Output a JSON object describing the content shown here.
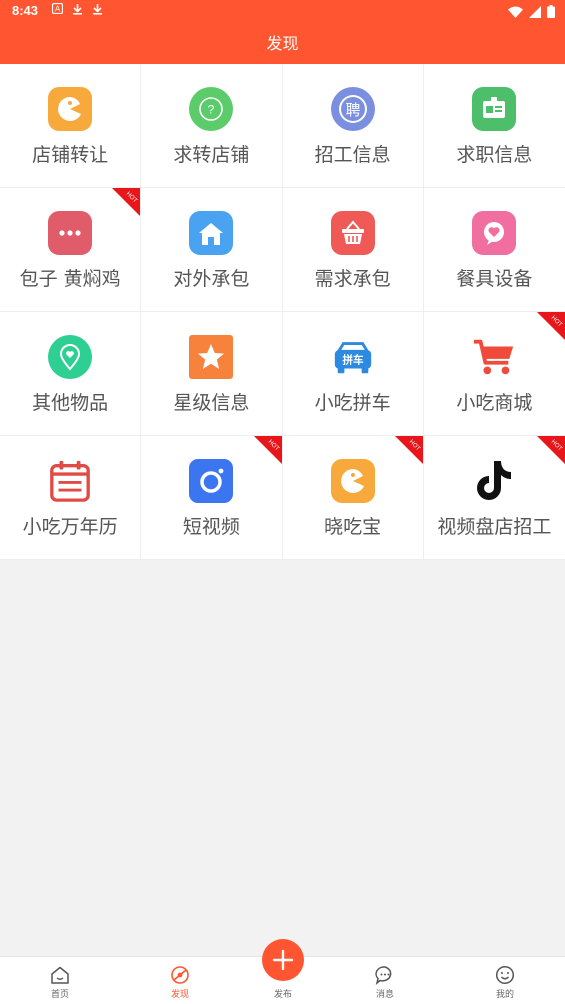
{
  "status_bar": {
    "time": "8:43",
    "left_icons": [
      "a-icon",
      "download-icon",
      "download-icon"
    ],
    "right_icons": [
      "wifi-icon",
      "signal-icon",
      "battery-icon"
    ]
  },
  "header": {
    "title": "发现"
  },
  "grid": {
    "items": [
      {
        "label": "店铺转让",
        "icon": "pacman-icon",
        "color": "#f7a93b",
        "hot": false
      },
      {
        "label": "求转店铺",
        "icon": "question-icon",
        "color": "#5ccc6b",
        "hot": false
      },
      {
        "label": "招工信息",
        "icon": "hire-icon",
        "color": "#7b8fe0",
        "hot": false
      },
      {
        "label": "求职信息",
        "icon": "id-card-icon",
        "color": "#4dbe6a",
        "hot": false
      },
      {
        "label": "包子 黄焖鸡",
        "icon": "more-dots-icon",
        "color": "#e05c6b",
        "hot": true
      },
      {
        "label": "对外承包",
        "icon": "house-icon",
        "color": "#4aa3f0",
        "hot": false
      },
      {
        "label": "需求承包",
        "icon": "basket-icon",
        "color": "#ef5a57",
        "hot": false
      },
      {
        "label": "餐具设备",
        "icon": "chat-heart-icon",
        "color": "#f06ea0",
        "hot": false
      },
      {
        "label": "其他物品",
        "icon": "location-heart-icon",
        "color": "#2ecf93",
        "hot": false
      },
      {
        "label": "星级信息",
        "icon": "star-icon",
        "color": "#f7823b",
        "hot": false
      },
      {
        "label": "小吃拼车",
        "icon": "carpool-icon",
        "color": "#2c8ae0",
        "hot": false,
        "badge_text": "拼车"
      },
      {
        "label": "小吃商城",
        "icon": "cart-icon",
        "color": "#f04b3a",
        "hot": true
      },
      {
        "label": "小吃万年历",
        "icon": "calendar-icon",
        "color": "#e04b45",
        "hot": false
      },
      {
        "label": "短视频",
        "icon": "camera-icon",
        "color": "#3b76f0",
        "hot": true
      },
      {
        "label": "晓吃宝",
        "icon": "pacman-icon",
        "color": "#f7a93b",
        "hot": true
      },
      {
        "label": "视频盘店招工",
        "icon": "tiktok-icon",
        "color": "#111111",
        "hot": true
      }
    ],
    "hot_text": "HOT"
  },
  "bottom_nav": {
    "items": [
      {
        "label": "首页",
        "icon": "home-icon",
        "active": false
      },
      {
        "label": "发现",
        "icon": "discover-icon",
        "active": true
      },
      {
        "label": "发布",
        "icon": "plus-icon",
        "active": false
      },
      {
        "label": "消息",
        "icon": "message-icon",
        "active": false
      },
      {
        "label": "我的",
        "icon": "smile-icon",
        "active": false
      }
    ]
  },
  "colors": {
    "accent": "#ff5530",
    "hot_badge": "#e8161b"
  }
}
